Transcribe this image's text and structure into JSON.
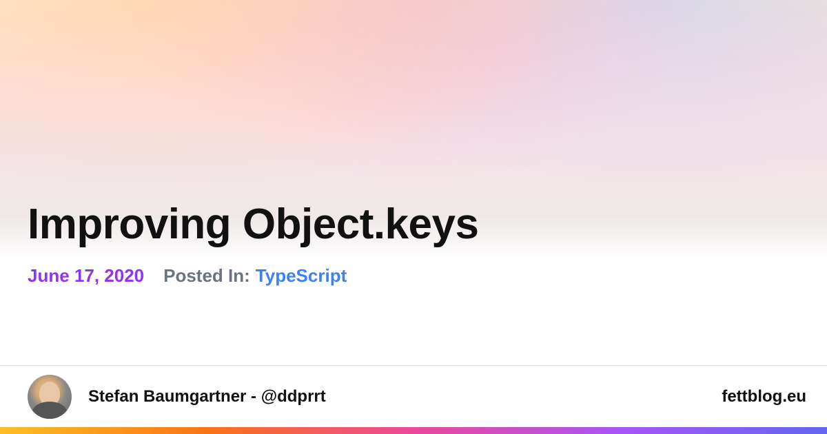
{
  "post": {
    "title": "Improving Object.keys",
    "date": "June 17, 2020",
    "posted_in_label": "Posted In:",
    "category": "TypeScript"
  },
  "footer": {
    "author_name": "Stefan Baumgartner - @ddprrt",
    "site": "fettblog.eu"
  }
}
